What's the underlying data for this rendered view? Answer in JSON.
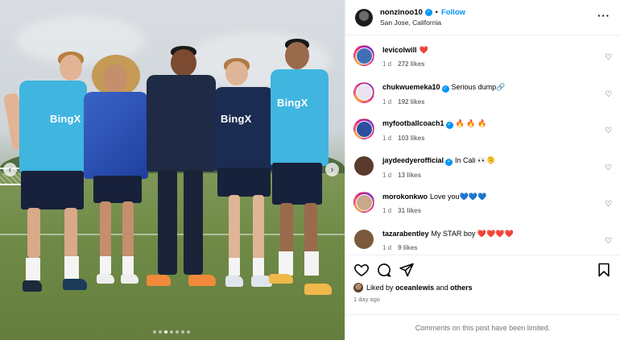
{
  "post": {
    "author": {
      "username": "nonzinoo10",
      "verified": true,
      "follow_label": "Follow",
      "separator": "•",
      "location": "San Jose, California",
      "more_label": "···"
    },
    "media": {
      "sponsor_text": "BingX",
      "carousel": {
        "total_slides": 7,
        "active_index": 2,
        "prev_label": "‹",
        "next_label": "›"
      }
    },
    "comments": [
      {
        "username": "levicolwill",
        "verified": false,
        "text": "❤️",
        "time": "1 d",
        "likes": "272 likes",
        "avatar_color": "#3f6fb5",
        "ring": true
      },
      {
        "username": "chukwuemeka10",
        "verified": true,
        "text": "Serious dump🔗",
        "time": "1 d",
        "likes": "192 likes",
        "avatar_color": "#e9e4f0",
        "ring": true
      },
      {
        "username": "myfootballcoach1",
        "verified": true,
        "text": "🔥 🔥 🔥",
        "time": "1 d",
        "likes": "103 likes",
        "avatar_color": "#2c4f9e",
        "ring": true
      },
      {
        "username": "jaydeedyerofficial",
        "verified": true,
        "text": "In Cali 👀🫠",
        "time": "1 d",
        "likes": "13 likes",
        "avatar_color": "#5a3b2b",
        "ring": false
      },
      {
        "username": "morokonkwo",
        "verified": false,
        "text": "Love you💙💙💙",
        "time": "1 d",
        "likes": "31 likes",
        "avatar_color": "#c9a78a",
        "ring": true
      },
      {
        "username": "tazarabentley",
        "verified": false,
        "text": "My STAR boy ❤️❤️❤️❤️",
        "time": "1 d",
        "likes": "9 likes",
        "avatar_color": "#7a5a3a",
        "ring": false
      }
    ],
    "liked_by": {
      "prefix": "Liked by",
      "user": "oceanlewis",
      "and": "and",
      "others": "others"
    },
    "time_ago": "1 day ago",
    "comments_limited": "Comments on this post have been limited.",
    "icons": {
      "like": "heart-icon",
      "comment": "comment-icon",
      "share": "share-icon",
      "save": "bookmark-icon"
    }
  }
}
